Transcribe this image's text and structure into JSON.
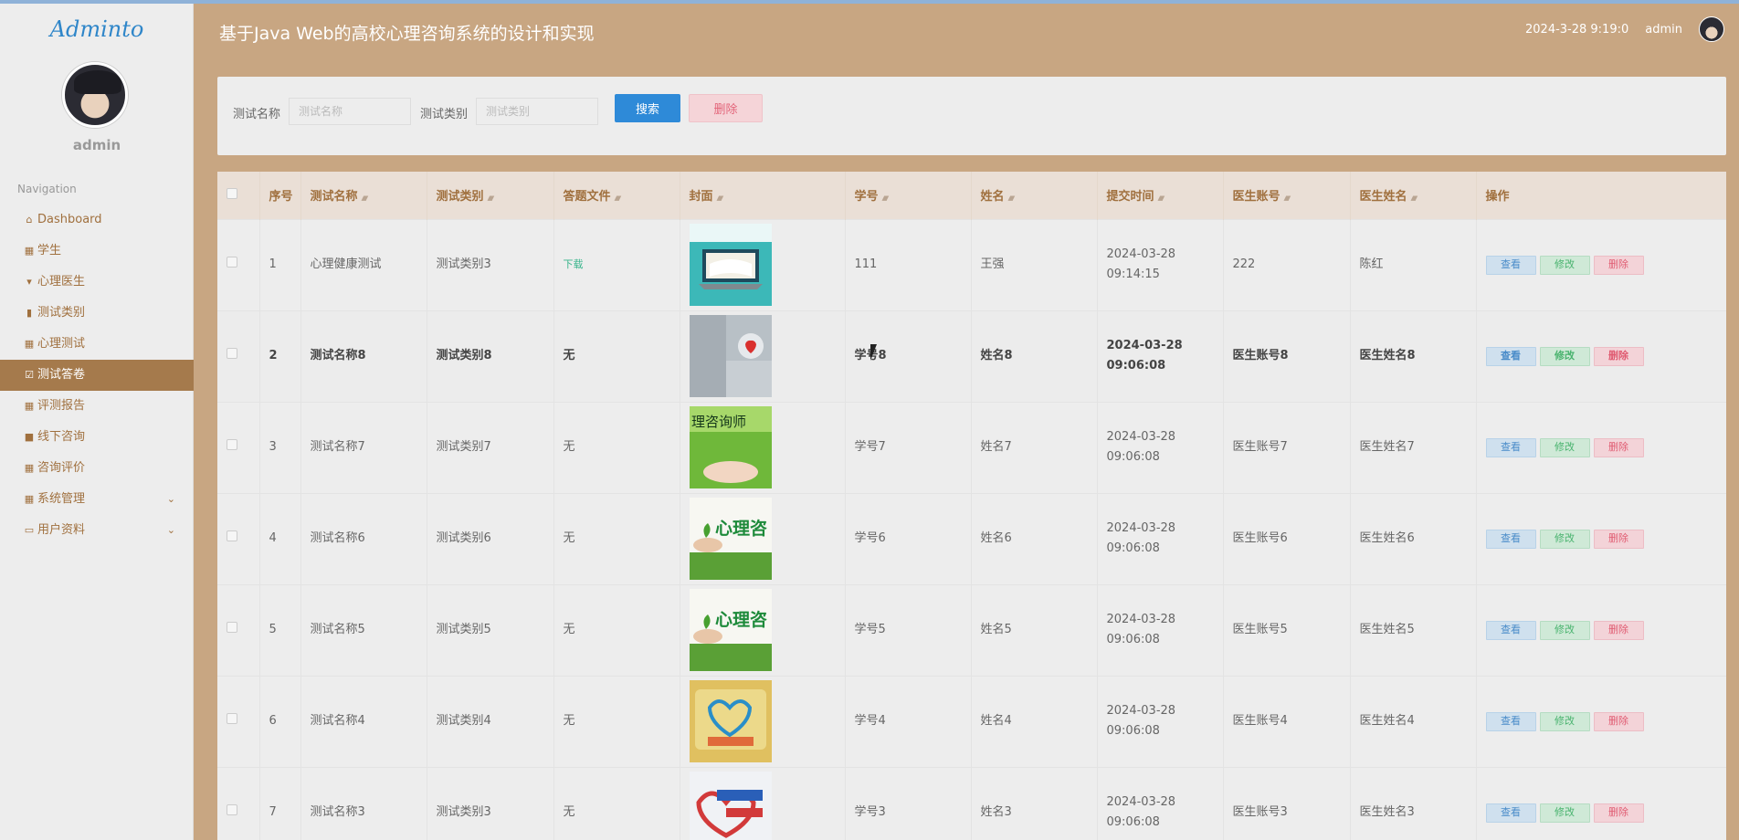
{
  "app": {
    "logo": "Adminto",
    "user": "admin",
    "title": "基于Java Web的高校心理咨询系统的设计和实现",
    "datetime": "2024-3-28 9:19:0"
  },
  "sidebar": {
    "nav_title": "Navigation",
    "items": [
      {
        "label": "Dashboard",
        "icon": "home-icon",
        "glyph": "⌂"
      },
      {
        "label": "学生",
        "icon": "grid-icon",
        "glyph": "▦"
      },
      {
        "label": "心理医生",
        "icon": "pin-icon",
        "glyph": "▾"
      },
      {
        "label": "测试类别",
        "icon": "bar-chart-icon",
        "glyph": "▮"
      },
      {
        "label": "心理测试",
        "icon": "grid-icon",
        "glyph": "▦"
      },
      {
        "label": "测试答卷",
        "icon": "check-square-icon",
        "glyph": "☑"
      },
      {
        "label": "评测报告",
        "icon": "table-icon",
        "glyph": "▦"
      },
      {
        "label": "线下咨询",
        "icon": "video-icon",
        "glyph": "■"
      },
      {
        "label": "咨询评价",
        "icon": "grid-icon",
        "glyph": "▦"
      },
      {
        "label": "系统管理",
        "icon": "grid-icon",
        "glyph": "▦"
      },
      {
        "label": "用户资料",
        "icon": "calendar-icon",
        "glyph": "▭"
      }
    ],
    "active_index": 5
  },
  "search": {
    "name_label": "测试名称",
    "name_placeholder": "测试名称",
    "type_label": "测试类别",
    "type_placeholder": "测试类别",
    "search_button": "搜索",
    "delete_button": "删除"
  },
  "table": {
    "columns": [
      "序号",
      "测试名称",
      "测试类别",
      "答题文件",
      "封面",
      "学号",
      "姓名",
      "提交时间",
      "医生账号",
      "医生姓名",
      "操作"
    ],
    "actions": {
      "view": "查看",
      "edit": "修改",
      "delete": "删除"
    },
    "rows": [
      {
        "no": "1",
        "name": "心理健康测试",
        "type": "测试类别3",
        "file": "下载",
        "student_id": "111",
        "student_name": "王强",
        "time": "2024-03-28 09:14:15",
        "doctor_id": "222",
        "doctor_name": "陈红"
      },
      {
        "no": "2",
        "name": "测试名称8",
        "type": "测试类别8",
        "file": "无",
        "student_id": "学号8",
        "student_name": "姓名8",
        "time": "2024-03-28 09:06:08",
        "doctor_id": "医生账号8",
        "doctor_name": "医生姓名8"
      },
      {
        "no": "3",
        "name": "测试名称7",
        "type": "测试类别7",
        "file": "无",
        "student_id": "学号7",
        "student_name": "姓名7",
        "time": "2024-03-28 09:06:08",
        "doctor_id": "医生账号7",
        "doctor_name": "医生姓名7"
      },
      {
        "no": "4",
        "name": "测试名称6",
        "type": "测试类别6",
        "file": "无",
        "student_id": "学号6",
        "student_name": "姓名6",
        "time": "2024-03-28 09:06:08",
        "doctor_id": "医生账号6",
        "doctor_name": "医生姓名6"
      },
      {
        "no": "5",
        "name": "测试名称5",
        "type": "测试类别5",
        "file": "无",
        "student_id": "学号5",
        "student_name": "姓名5",
        "time": "2024-03-28 09:06:08",
        "doctor_id": "医生账号5",
        "doctor_name": "医生姓名5"
      },
      {
        "no": "6",
        "name": "测试名称4",
        "type": "测试类别4",
        "file": "无",
        "student_id": "学号4",
        "student_name": "姓名4",
        "time": "2024-03-28 09:06:08",
        "doctor_id": "医生账号4",
        "doctor_name": "医生姓名4"
      },
      {
        "no": "7",
        "name": "测试名称3",
        "type": "测试类别3",
        "file": "无",
        "student_id": "学号3",
        "student_name": "姓名3",
        "time": "2024-03-28 09:06:08",
        "doctor_id": "医生账号3",
        "doctor_name": "医生姓名3"
      }
    ],
    "highlight_row": 1
  },
  "colors": {
    "accent": "#c8a682",
    "active_nav": "#a57a4c",
    "primary": "#2e8ad8"
  }
}
